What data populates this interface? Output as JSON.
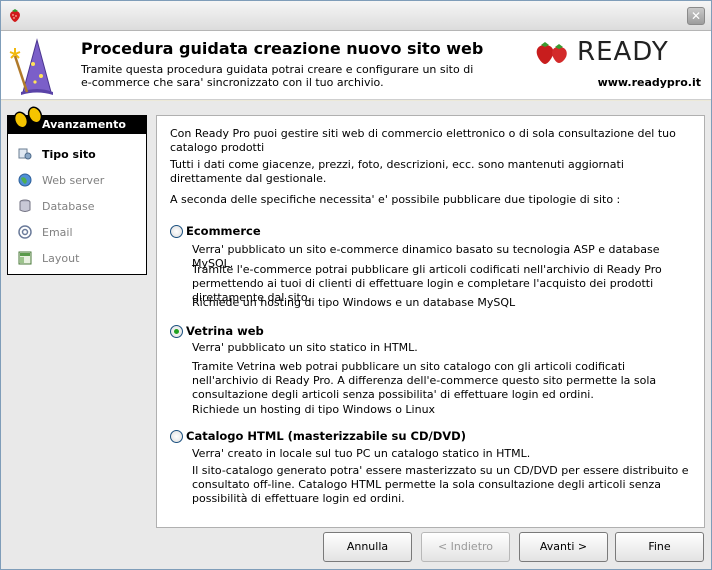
{
  "header": {
    "title": "Procedura guidata creazione nuovo sito web",
    "subtitle": "Tramite questa procedura guidata potrai creare e configurare un sito di e-commerce che sara' sincronizzato con il tuo archivio.",
    "brand_name": "READY",
    "brand_url": "www.readypro.it"
  },
  "sidebar": {
    "heading": "Avanzamento",
    "steps": [
      {
        "label": "Tipo sito",
        "icon": "settings-icon",
        "active": true
      },
      {
        "label": "Web server",
        "icon": "globe-icon",
        "active": false
      },
      {
        "label": "Database",
        "icon": "database-icon",
        "active": false
      },
      {
        "label": "Email",
        "icon": "email-icon",
        "active": false
      },
      {
        "label": "Layout",
        "icon": "layout-icon",
        "active": false
      }
    ]
  },
  "content": {
    "intro1": "Con Ready Pro puoi gestire siti web di commercio elettronico o di sola consultazione del tuo catalogo prodotti",
    "intro2": "Tutti i dati come giacenze, prezzi, foto, descrizioni, ecc. sono mantenuti aggiornati direttamente dal gestionale.",
    "intro3": "A seconda delle specifiche necessita' e' possibile pubblicare due tipologie di sito :",
    "options": [
      {
        "label": "Ecommerce",
        "checked": false,
        "desc1": "Verra' pubblicato un sito e-commerce dinamico basato su tecnologia ASP e database MySQL.",
        "desc2": "Tramite l'e-commerce potrai pubblicare gli articoli codificati nell'archivio di Ready Pro permettendo ai tuoi di clienti di effettuare login e completare l'acquisto dei prodotti direttamente dal sito.",
        "desc3": "Richiede un hosting di tipo Windows e un database MySQL"
      },
      {
        "label": "Vetrina web",
        "checked": true,
        "desc1": "Verra' pubblicato un sito statico in HTML.",
        "desc2": "Tramite Vetrina web potrai pubblicare un sito catalogo con gli articoli codificati nell'archivio di Ready Pro. A differenza dell'e-commerce questo sito permette la sola consultazione degli articoli senza possibilita' di effettuare login ed ordini.",
        "desc3": "Richiede un hosting di tipo Windows o Linux"
      },
      {
        "label": "Catalogo HTML (masterizzabile su CD/DVD)",
        "checked": false,
        "desc1": "Verra' creato in locale sul tuo PC un catalogo statico in HTML.",
        "desc2": "Il sito-catalogo generato potra' essere masterizzato su un CD/DVD per essere distribuito e consultato off-line. Catalogo HTML permette la sola consultazione degli articoli senza possibilità di effettuare login ed ordini."
      }
    ]
  },
  "buttons": {
    "cancel": "Annulla",
    "back": "< Indietro",
    "next": "Avanti >",
    "finish": "Fine"
  }
}
